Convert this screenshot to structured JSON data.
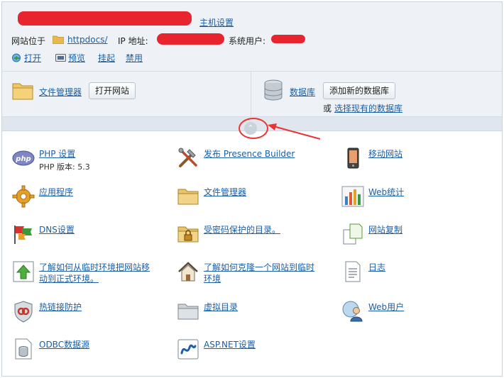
{
  "header": {
    "host_settings": "主机设置",
    "site_location_label": "网站位于",
    "docroot": "httpdocs/",
    "ip_label": "IP 地址:",
    "system_user_label": "系统用户:",
    "actions": [
      "打开",
      "预览",
      "挂起",
      "禁用"
    ]
  },
  "quick": {
    "file_manager": "文件管理器",
    "open_site": "打开网站",
    "database": "数据库",
    "add_database": "添加新的数据库",
    "or": "或",
    "select_database": "选择现有的数据库"
  },
  "tools": [
    {
      "label": "PHP 设置",
      "sub": "PHP 版本: 5.3",
      "icon": "php-icon"
    },
    {
      "label": "发布 Presence Builder",
      "icon": "tools-icon"
    },
    {
      "label": "移动网站",
      "icon": "mobile-icon"
    },
    {
      "label": "应用程序",
      "icon": "gear-icon"
    },
    {
      "label": "文件管理器",
      "icon": "folder-icon"
    },
    {
      "label": "Web统计",
      "icon": "stats-icon"
    },
    {
      "label": "DNS设置",
      "icon": "flags-icon"
    },
    {
      "label": "受密码保护的目录。",
      "icon": "locked-folder-icon"
    },
    {
      "label": "网站复制",
      "icon": "copy-icon"
    },
    {
      "label": "了解如何从临时环境把网站移动到正式环境。",
      "label_lines": [
        "了解如何从临时环境把网站移",
        "动到正式环境。"
      ],
      "icon": "upload-icon"
    },
    {
      "label": "了解如何克隆一个网站到临时环境",
      "label_lines": [
        "了解如何克隆一个网站到临时",
        "环境"
      ],
      "icon": "house-icon"
    },
    {
      "label": "日志",
      "icon": "log-icon"
    },
    {
      "label": "热链接防护",
      "icon": "shield-icon"
    },
    {
      "label": "虚拟目录",
      "icon": "folder-icon"
    },
    {
      "label": "Web用户",
      "icon": "web-user-icon"
    },
    {
      "label": "ODBC数据源",
      "icon": "odbc-icon"
    },
    {
      "label": "ASP.NET设置",
      "icon": "aspnet-icon"
    }
  ],
  "colors": {
    "link": "#1a5fa8",
    "annotation": "#e33333",
    "header_bg": "#eef2f6"
  }
}
